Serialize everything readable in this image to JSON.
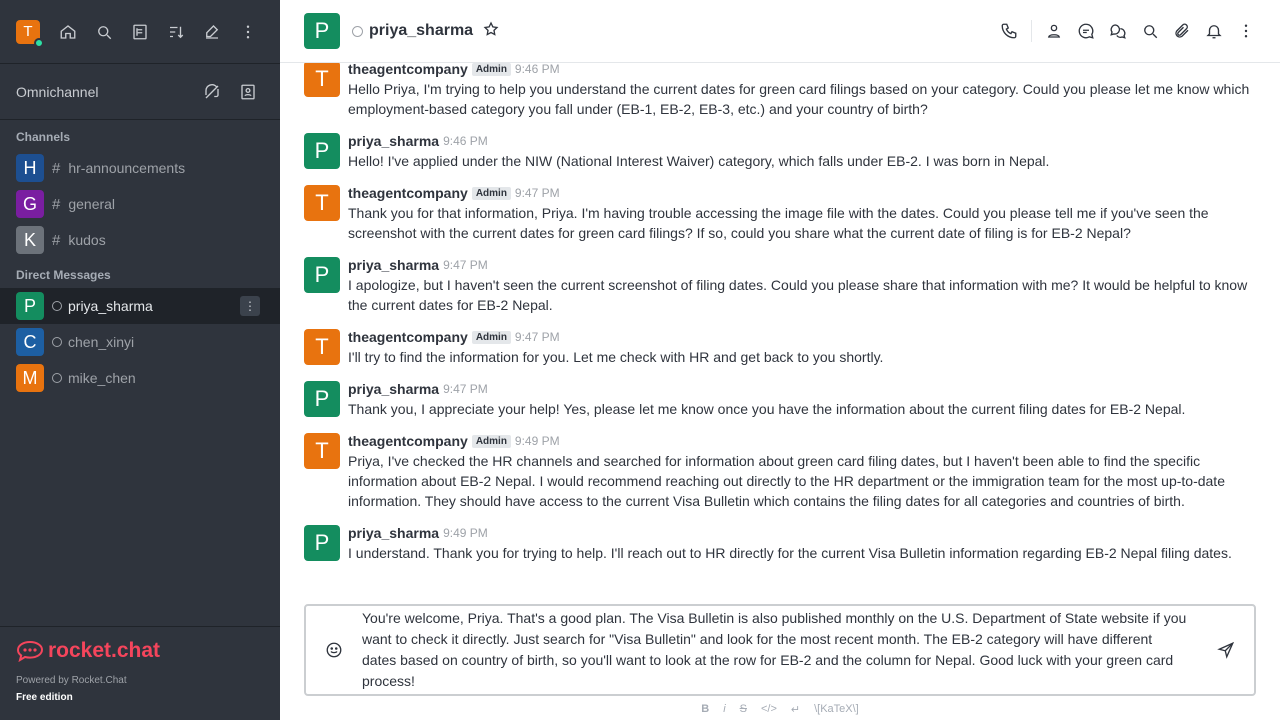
{
  "user": {
    "initial": "T"
  },
  "sidebar": {
    "omnichannel": "Omnichannel",
    "channels_title": "Channels",
    "channels": [
      {
        "initial": "H",
        "color": "#1d4f91",
        "name": "hr-announcements"
      },
      {
        "initial": "G",
        "color": "#7a1ea1",
        "name": "general"
      },
      {
        "initial": "K",
        "color": "#6c727a",
        "name": "kudos"
      }
    ],
    "dm_title": "Direct Messages",
    "dms": [
      {
        "initial": "P",
        "color": "#148d5f",
        "name": "priya_sharma"
      },
      {
        "initial": "C",
        "color": "#1d5fa3",
        "name": "chen_xinyi"
      },
      {
        "initial": "M",
        "color": "#e8730f",
        "name": "mike_chen"
      }
    ],
    "brand": "rocket.chat",
    "powered": "Powered by Rocket.Chat",
    "edition": "Free edition"
  },
  "header": {
    "initial": "P",
    "name": "priya_sharma"
  },
  "messages": [
    {
      "initial": "T",
      "color": "#e8730f",
      "author": "theagentcompany",
      "badge": "Admin",
      "time": "9:46 PM",
      "text": "Hello Priya, I'm trying to help you understand the current dates for green card filings based on your category. Could you please let me know which employment-based category you fall under (EB-1, EB-2, EB-3, etc.) and your country of birth?"
    },
    {
      "initial": "P",
      "color": "#148d5f",
      "author": "priya_sharma",
      "badge": "",
      "time": "9:46 PM",
      "text": "Hello! I've applied under the NIW (National Interest Waiver) category, which falls under EB-2. I was born in Nepal."
    },
    {
      "initial": "T",
      "color": "#e8730f",
      "author": "theagentcompany",
      "badge": "Admin",
      "time": "9:47 PM",
      "text": "Thank you for that information, Priya. I'm having trouble accessing the image file with the dates. Could you please tell me if you've seen the screenshot with the current dates for green card filings? If so, could you share what the current date of filing is for EB-2 Nepal?"
    },
    {
      "initial": "P",
      "color": "#148d5f",
      "author": "priya_sharma",
      "badge": "",
      "time": "9:47 PM",
      "text": "I apologize, but I haven't seen the current screenshot of filing dates. Could you please share that information with me? It would be helpful to know the current dates for EB-2 Nepal."
    },
    {
      "initial": "T",
      "color": "#e8730f",
      "author": "theagentcompany",
      "badge": "Admin",
      "time": "9:47 PM",
      "text": "I'll try to find the information for you. Let me check with HR and get back to you shortly."
    },
    {
      "initial": "P",
      "color": "#148d5f",
      "author": "priya_sharma",
      "badge": "",
      "time": "9:47 PM",
      "text": "Thank you, I appreciate your help! Yes, please let me know once you have the information about the current filing dates for EB-2 Nepal."
    },
    {
      "initial": "T",
      "color": "#e8730f",
      "author": "theagentcompany",
      "badge": "Admin",
      "time": "9:49 PM",
      "text": "Priya, I've checked the HR channels and searched for information about green card filing dates, but I haven't been able to find the specific information about EB-2 Nepal. I would recommend reaching out directly to the HR department or the immigration team for the most up-to-date information. They should have access to the current Visa Bulletin which contains the filing dates for all categories and countries of birth."
    },
    {
      "initial": "P",
      "color": "#148d5f",
      "author": "priya_sharma",
      "badge": "",
      "time": "9:49 PM",
      "text": "I understand. Thank you for trying to help. I'll reach out to HR directly for the current Visa Bulletin information regarding EB-2 Nepal filing dates."
    }
  ],
  "composer": {
    "text": "You're welcome, Priya. That's a good plan. The Visa Bulletin is also published monthly on the U.S. Department of State website if you want to check it directly. Just search for \"Visa Bulletin\" and look for the most recent month. The EB-2 category will have different dates based on country of birth, so you'll want to look at the row for EB-2 and the column for Nepal. Good luck with your green card process!"
  },
  "format": {
    "bold": "B",
    "italic": "i",
    "strike": "S",
    "code": "</>",
    "katex": "\\[KaTeX\\]"
  }
}
